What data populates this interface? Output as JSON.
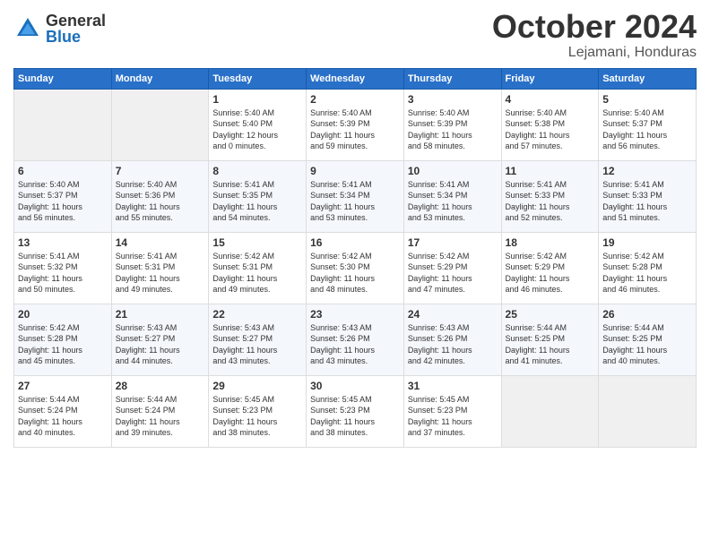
{
  "logo": {
    "general": "General",
    "blue": "Blue"
  },
  "title": "October 2024",
  "location": "Lejamani, Honduras",
  "days_of_week": [
    "Sunday",
    "Monday",
    "Tuesday",
    "Wednesday",
    "Thursday",
    "Friday",
    "Saturday"
  ],
  "weeks": [
    [
      {
        "num": "",
        "info": ""
      },
      {
        "num": "",
        "info": ""
      },
      {
        "num": "1",
        "info": "Sunrise: 5:40 AM\nSunset: 5:40 PM\nDaylight: 12 hours\nand 0 minutes."
      },
      {
        "num": "2",
        "info": "Sunrise: 5:40 AM\nSunset: 5:39 PM\nDaylight: 11 hours\nand 59 minutes."
      },
      {
        "num": "3",
        "info": "Sunrise: 5:40 AM\nSunset: 5:39 PM\nDaylight: 11 hours\nand 58 minutes."
      },
      {
        "num": "4",
        "info": "Sunrise: 5:40 AM\nSunset: 5:38 PM\nDaylight: 11 hours\nand 57 minutes."
      },
      {
        "num": "5",
        "info": "Sunrise: 5:40 AM\nSunset: 5:37 PM\nDaylight: 11 hours\nand 56 minutes."
      }
    ],
    [
      {
        "num": "6",
        "info": "Sunrise: 5:40 AM\nSunset: 5:37 PM\nDaylight: 11 hours\nand 56 minutes."
      },
      {
        "num": "7",
        "info": "Sunrise: 5:40 AM\nSunset: 5:36 PM\nDaylight: 11 hours\nand 55 minutes."
      },
      {
        "num": "8",
        "info": "Sunrise: 5:41 AM\nSunset: 5:35 PM\nDaylight: 11 hours\nand 54 minutes."
      },
      {
        "num": "9",
        "info": "Sunrise: 5:41 AM\nSunset: 5:34 PM\nDaylight: 11 hours\nand 53 minutes."
      },
      {
        "num": "10",
        "info": "Sunrise: 5:41 AM\nSunset: 5:34 PM\nDaylight: 11 hours\nand 53 minutes."
      },
      {
        "num": "11",
        "info": "Sunrise: 5:41 AM\nSunset: 5:33 PM\nDaylight: 11 hours\nand 52 minutes."
      },
      {
        "num": "12",
        "info": "Sunrise: 5:41 AM\nSunset: 5:33 PM\nDaylight: 11 hours\nand 51 minutes."
      }
    ],
    [
      {
        "num": "13",
        "info": "Sunrise: 5:41 AM\nSunset: 5:32 PM\nDaylight: 11 hours\nand 50 minutes."
      },
      {
        "num": "14",
        "info": "Sunrise: 5:41 AM\nSunset: 5:31 PM\nDaylight: 11 hours\nand 49 minutes."
      },
      {
        "num": "15",
        "info": "Sunrise: 5:42 AM\nSunset: 5:31 PM\nDaylight: 11 hours\nand 49 minutes."
      },
      {
        "num": "16",
        "info": "Sunrise: 5:42 AM\nSunset: 5:30 PM\nDaylight: 11 hours\nand 48 minutes."
      },
      {
        "num": "17",
        "info": "Sunrise: 5:42 AM\nSunset: 5:29 PM\nDaylight: 11 hours\nand 47 minutes."
      },
      {
        "num": "18",
        "info": "Sunrise: 5:42 AM\nSunset: 5:29 PM\nDaylight: 11 hours\nand 46 minutes."
      },
      {
        "num": "19",
        "info": "Sunrise: 5:42 AM\nSunset: 5:28 PM\nDaylight: 11 hours\nand 46 minutes."
      }
    ],
    [
      {
        "num": "20",
        "info": "Sunrise: 5:42 AM\nSunset: 5:28 PM\nDaylight: 11 hours\nand 45 minutes."
      },
      {
        "num": "21",
        "info": "Sunrise: 5:43 AM\nSunset: 5:27 PM\nDaylight: 11 hours\nand 44 minutes."
      },
      {
        "num": "22",
        "info": "Sunrise: 5:43 AM\nSunset: 5:27 PM\nDaylight: 11 hours\nand 43 minutes."
      },
      {
        "num": "23",
        "info": "Sunrise: 5:43 AM\nSunset: 5:26 PM\nDaylight: 11 hours\nand 43 minutes."
      },
      {
        "num": "24",
        "info": "Sunrise: 5:43 AM\nSunset: 5:26 PM\nDaylight: 11 hours\nand 42 minutes."
      },
      {
        "num": "25",
        "info": "Sunrise: 5:44 AM\nSunset: 5:25 PM\nDaylight: 11 hours\nand 41 minutes."
      },
      {
        "num": "26",
        "info": "Sunrise: 5:44 AM\nSunset: 5:25 PM\nDaylight: 11 hours\nand 40 minutes."
      }
    ],
    [
      {
        "num": "27",
        "info": "Sunrise: 5:44 AM\nSunset: 5:24 PM\nDaylight: 11 hours\nand 40 minutes."
      },
      {
        "num": "28",
        "info": "Sunrise: 5:44 AM\nSunset: 5:24 PM\nDaylight: 11 hours\nand 39 minutes."
      },
      {
        "num": "29",
        "info": "Sunrise: 5:45 AM\nSunset: 5:23 PM\nDaylight: 11 hours\nand 38 minutes."
      },
      {
        "num": "30",
        "info": "Sunrise: 5:45 AM\nSunset: 5:23 PM\nDaylight: 11 hours\nand 38 minutes."
      },
      {
        "num": "31",
        "info": "Sunrise: 5:45 AM\nSunset: 5:23 PM\nDaylight: 11 hours\nand 37 minutes."
      },
      {
        "num": "",
        "info": ""
      },
      {
        "num": "",
        "info": ""
      }
    ]
  ]
}
